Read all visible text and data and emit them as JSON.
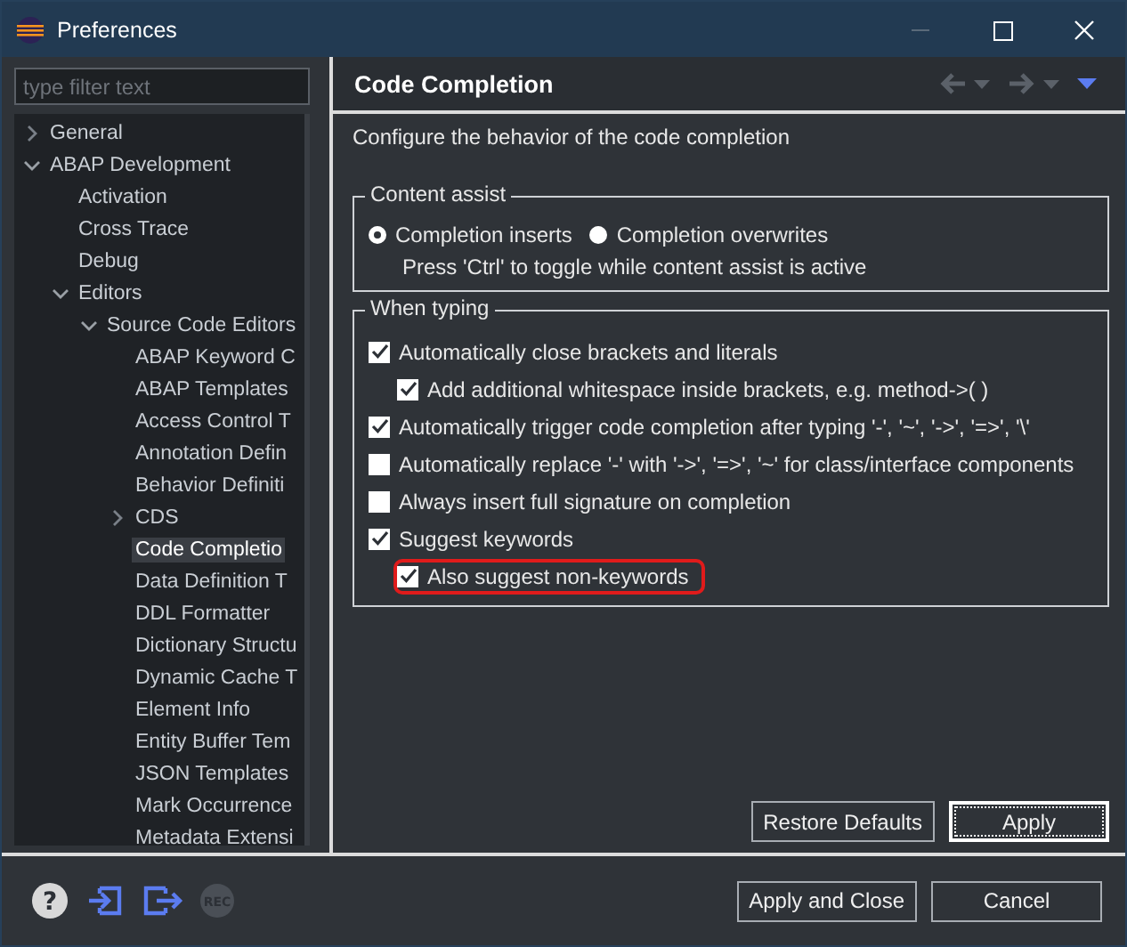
{
  "window": {
    "title": "Preferences"
  },
  "filter": {
    "placeholder": "type filter text"
  },
  "tree": [
    {
      "label": "General",
      "expanded": false,
      "selected": false
    },
    {
      "label": "ABAP Development",
      "expanded": true,
      "selected": false,
      "children": [
        {
          "label": "Activation",
          "selected": false
        },
        {
          "label": "Cross Trace",
          "selected": false
        },
        {
          "label": "Debug",
          "selected": false
        },
        {
          "label": "Editors",
          "expanded": true,
          "selected": false,
          "children": [
            {
              "label": "Source Code Editors",
              "expanded": true,
              "selected": false,
              "children": [
                {
                  "label": "ABAP Keyword C",
                  "selected": false
                },
                {
                  "label": "ABAP Templates",
                  "selected": false
                },
                {
                  "label": "Access Control T",
                  "selected": false
                },
                {
                  "label": "Annotation Defin",
                  "selected": false
                },
                {
                  "label": "Behavior Definiti",
                  "selected": false
                },
                {
                  "label": "CDS",
                  "expanded": false,
                  "selected": false
                },
                {
                  "label": "Code Completio",
                  "selected": true
                },
                {
                  "label": "Data Definition T",
                  "selected": false
                },
                {
                  "label": "DDL Formatter",
                  "selected": false
                },
                {
                  "label": "Dictionary Structu",
                  "selected": false
                },
                {
                  "label": "Dynamic Cache T",
                  "selected": false
                },
                {
                  "label": "Element Info",
                  "selected": false
                },
                {
                  "label": "Entity Buffer Tem",
                  "selected": false
                },
                {
                  "label": "JSON Templates",
                  "selected": false
                },
                {
                  "label": "Mark Occurrence",
                  "selected": false
                },
                {
                  "label": "Metadata Extensi",
                  "selected": false
                }
              ]
            }
          ]
        }
      ]
    }
  ],
  "page": {
    "title": "Code Completion",
    "description": "Configure the behavior of the code completion",
    "content_assist": {
      "title": "Content assist",
      "options": [
        {
          "label": "Completion inserts",
          "selected": true
        },
        {
          "label": "Completion overwrites",
          "selected": false
        }
      ],
      "hint": "Press 'Ctrl' to toggle while content assist is active"
    },
    "when_typing": {
      "title": "When typing",
      "options": [
        {
          "label": "Automatically close brackets and literals",
          "checked": true,
          "highlighted": false,
          "children": [
            {
              "label": "Add additional whitespace inside brackets, e.g. method->( )",
              "checked": true,
              "highlighted": false
            }
          ]
        },
        {
          "label": "Automatically trigger code completion after typing '-', '~', '->', '=>', '\\'",
          "checked": true,
          "highlighted": false
        },
        {
          "label": "Automatically replace '-' with '->', '=>', '~' for class/interface components",
          "checked": false,
          "highlighted": false
        },
        {
          "label": "Always insert full signature on completion",
          "checked": false,
          "highlighted": false
        },
        {
          "label": "Suggest keywords",
          "checked": true,
          "highlighted": false,
          "children": [
            {
              "label": "Also suggest non-keywords",
              "checked": true,
              "highlighted": true
            }
          ]
        }
      ]
    },
    "buttons": [
      {
        "label": "Restore Defaults",
        "default": false
      },
      {
        "label": "Apply",
        "default": true
      }
    ]
  },
  "footer": {
    "help_glyph": "?",
    "record_label": "REC",
    "buttons": [
      {
        "label": "Apply and Close"
      },
      {
        "label": "Cancel"
      }
    ]
  }
}
